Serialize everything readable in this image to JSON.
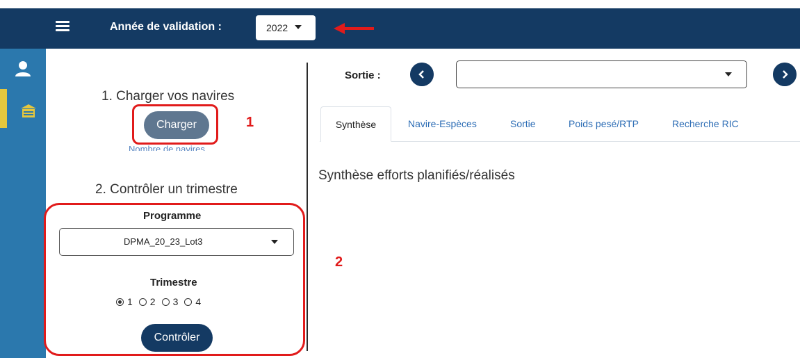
{
  "header": {
    "menu_icon": "hamburger-menu-icon",
    "year_label": "Année de validation :",
    "year_value": "2022",
    "annotation_arrow_color": "#e11b1b"
  },
  "rail": {
    "items": [
      {
        "icon": "user-icon"
      },
      {
        "icon": "ship-icon",
        "active": true
      }
    ]
  },
  "left_panel": {
    "step1_title": "1. Charger vos navires",
    "charger_label": "Charger",
    "nb_navires_text": "Nombre de navires",
    "annotation_1": "1",
    "step2_title": "2. Contrôler un trimestre",
    "programme_label": "Programme",
    "programme_value": "DPMA_20_23_Lot3",
    "trimestre_label": "Trimestre",
    "trimestres": [
      {
        "label": "1",
        "checked": true
      },
      {
        "label": "2",
        "checked": false
      },
      {
        "label": "3",
        "checked": false
      },
      {
        "label": "4",
        "checked": false
      }
    ],
    "controler_label": "Contrôler",
    "annotation_2": "2"
  },
  "main": {
    "sortie_label": "Sortie :",
    "sortie_value": "",
    "tabs": [
      {
        "label": "Synthèse",
        "active": true
      },
      {
        "label": "Navire-Espèces",
        "active": false
      },
      {
        "label": "Sortie",
        "active": false
      },
      {
        "label": "Poids pesé/RTP",
        "active": false
      },
      {
        "label": "Recherche RIC",
        "active": false
      }
    ],
    "section_title": "Synthèse efforts planifiés/réalisés"
  },
  "colors": {
    "navy": "#143a63",
    "rail_blue": "#2b78ad",
    "active_yellow": "#e5c73d",
    "annotation_red": "#e11b1b",
    "link_blue": "#2d6db5"
  }
}
